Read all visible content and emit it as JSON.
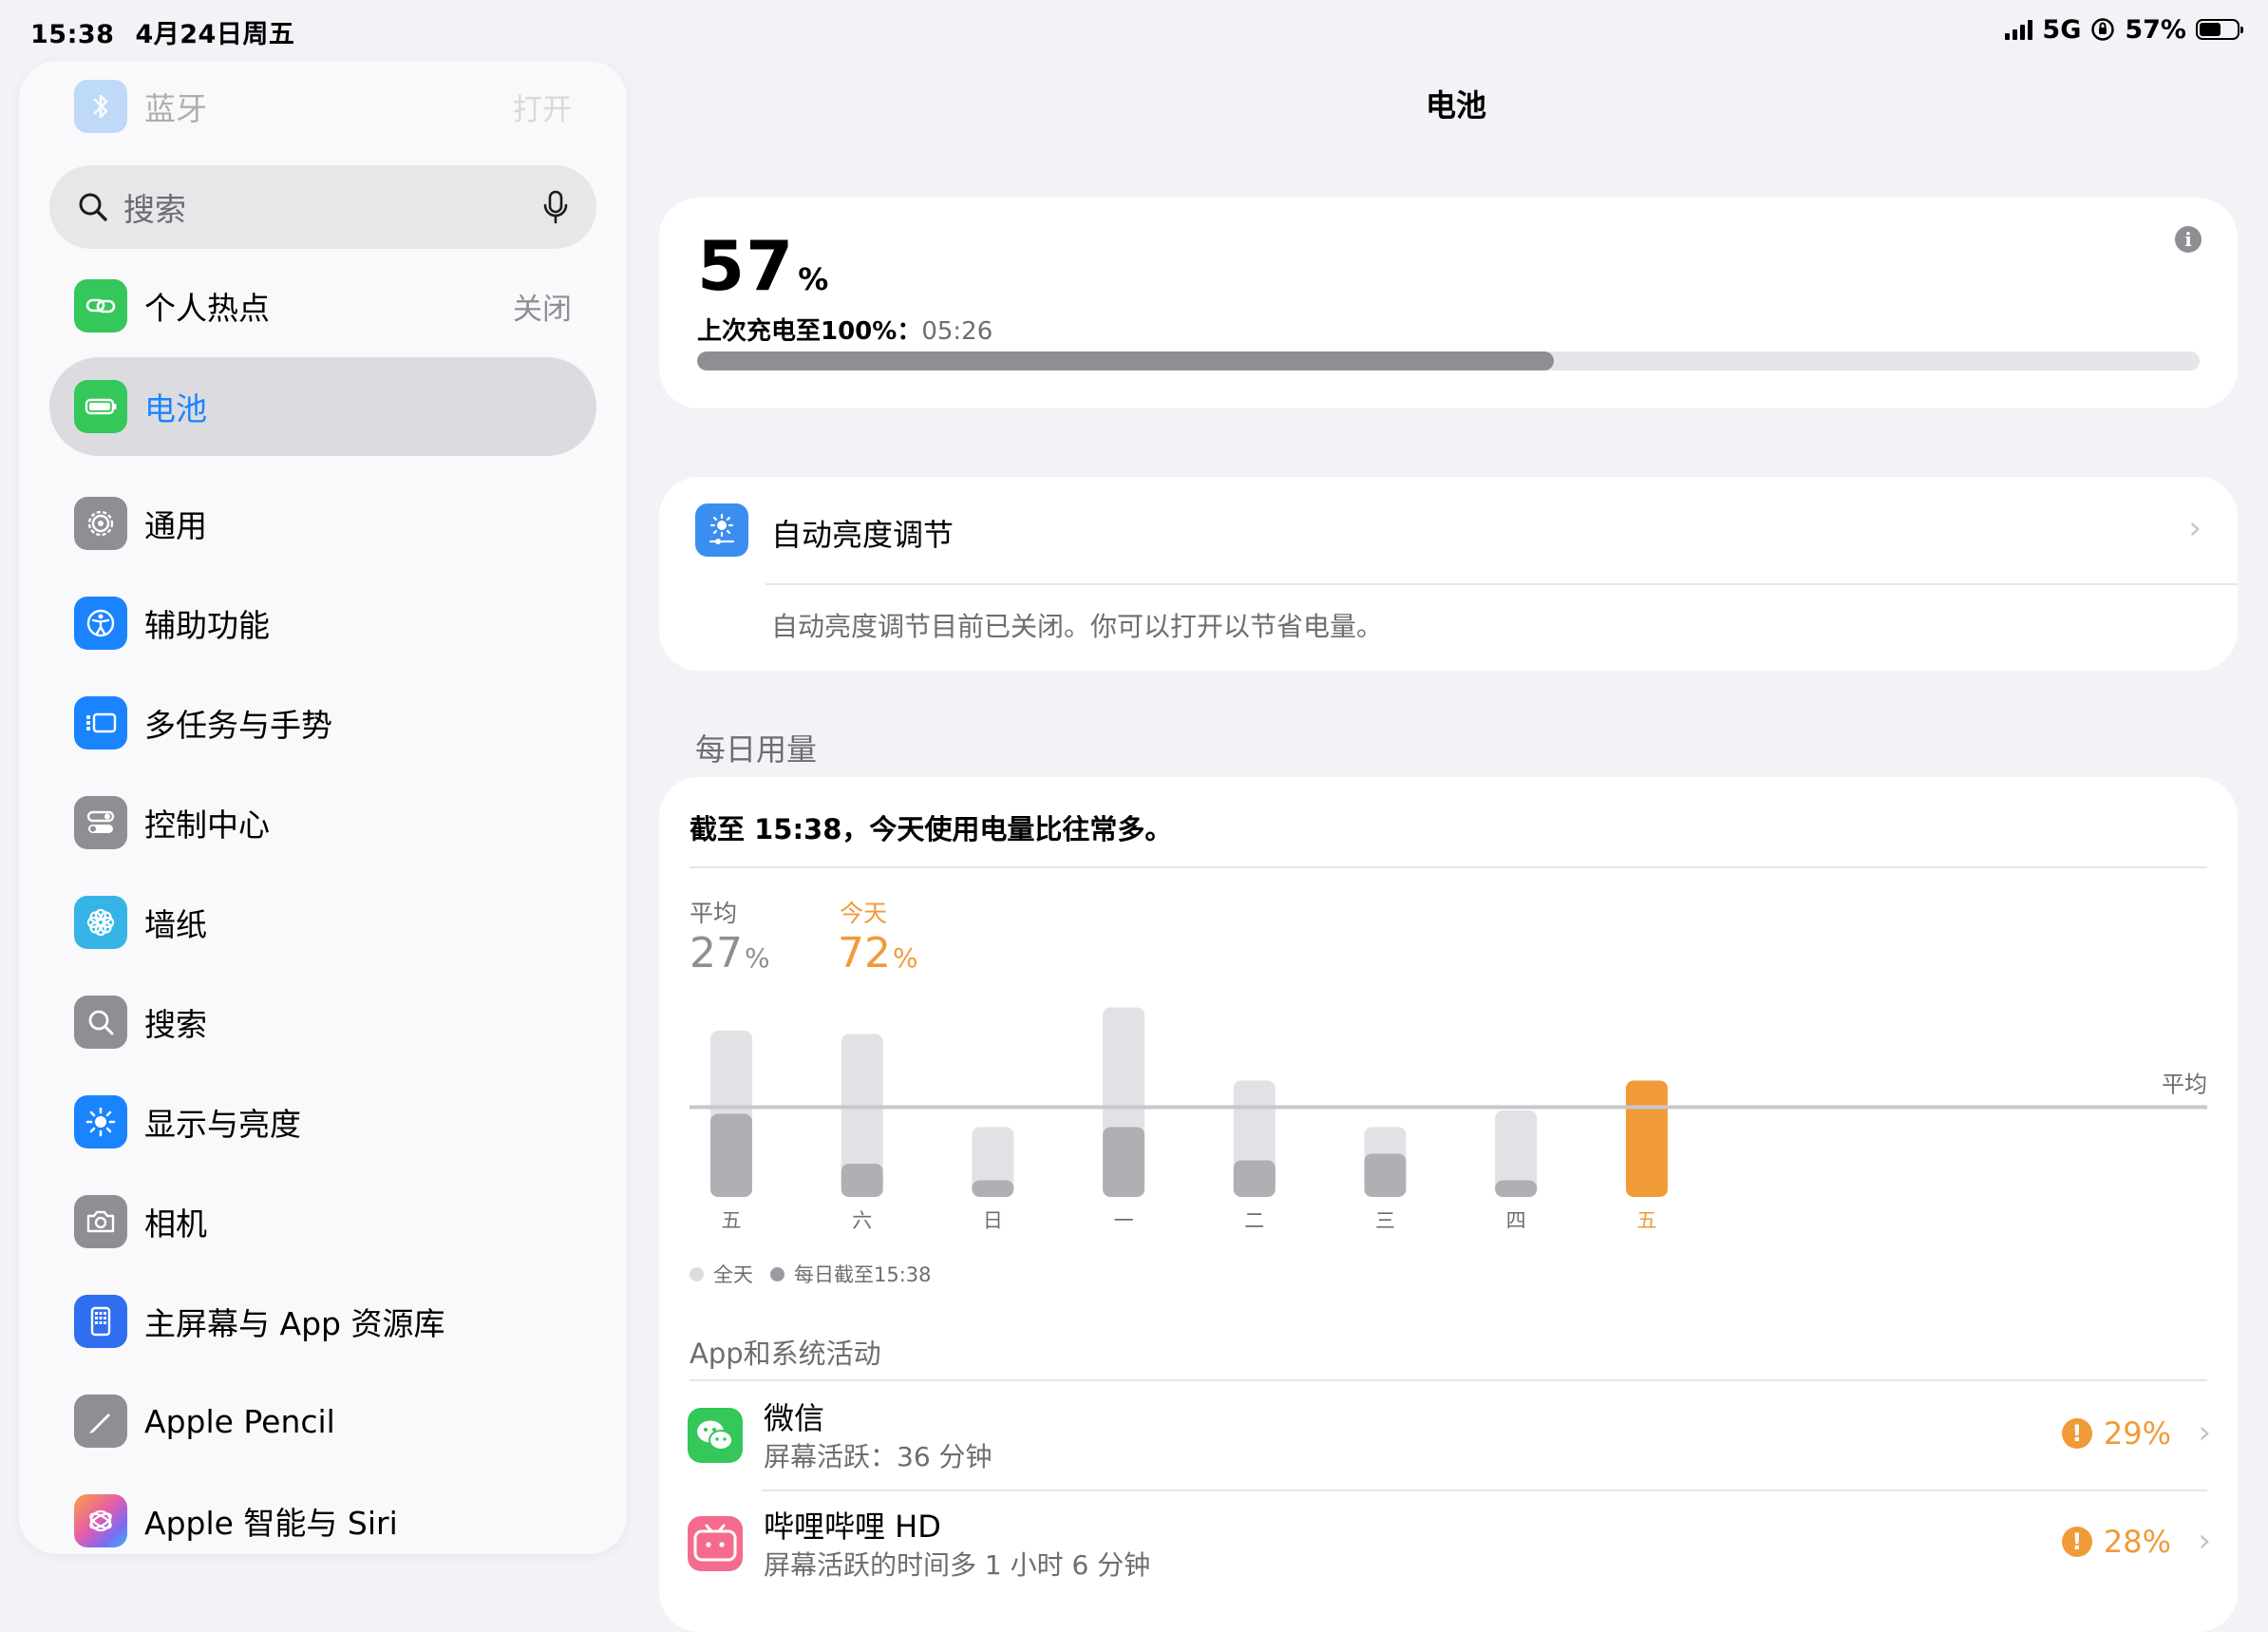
{
  "status_bar": {
    "time": "15:38",
    "date": "4月24日周五",
    "network": "5G",
    "battery_percent": "57%",
    "battery_level": 0.57
  },
  "sidebar": {
    "search_placeholder": "搜索",
    "items": [
      {
        "label": "蓝牙",
        "value": "打开",
        "icon": "bluetooth-icon",
        "color": "#3a8ef0"
      },
      {
        "label": "个人热点",
        "value": "关闭",
        "icon": "hotspot-icon",
        "color": "#34c759"
      },
      {
        "label": "电池",
        "value": "",
        "icon": "battery-icon",
        "color": "#34c759",
        "selected": true
      },
      {
        "label": "通用",
        "value": "",
        "icon": "gear-icon",
        "color": "#8e8e93"
      },
      {
        "label": "辅助功能",
        "value": "",
        "icon": "accessibility-icon",
        "color": "#1a84ff"
      },
      {
        "label": "多任务与手势",
        "value": "",
        "icon": "multitasking-icon",
        "color": "#1a84ff"
      },
      {
        "label": "控制中心",
        "value": "",
        "icon": "control-center-icon",
        "color": "#8e8e93"
      },
      {
        "label": "墙纸",
        "value": "",
        "icon": "wallpaper-icon",
        "color": "#36b4e8"
      },
      {
        "label": "搜索",
        "value": "",
        "icon": "search-icon",
        "color": "#8e8e93"
      },
      {
        "label": "显示与亮度",
        "value": "",
        "icon": "brightness-icon",
        "color": "#1a84ff"
      },
      {
        "label": "相机",
        "value": "",
        "icon": "camera-icon",
        "color": "#8e8e93"
      },
      {
        "label": "主屏幕与 App 资源库",
        "value": "",
        "icon": "home-screen-icon",
        "color": "#2f6ef0"
      },
      {
        "label": "Apple Pencil",
        "value": "",
        "icon": "pencil-icon",
        "color": "#8e8e93"
      },
      {
        "label": "Apple 智能与 Siri",
        "value": "",
        "icon": "siri-icon",
        "color": "#e57bd0"
      }
    ]
  },
  "main": {
    "title": "电池",
    "battery": {
      "percent": "57",
      "percent_unit": "%",
      "level": 0.57,
      "last_charge_label": "上次充电至100%：",
      "last_charge_time": "05:26"
    },
    "auto_brightness": {
      "title": "自动亮度调节",
      "description": "自动亮度调节目前已关闭。你可以打开以节省电量。"
    },
    "daily_usage_title": "每日用量",
    "usage": {
      "headline": "截至 15:38，今天使用电量比往常多。",
      "average_label": "平均",
      "average_value": "27",
      "today_label": "今天",
      "today_value": "72",
      "unit": "%"
    },
    "legend": {
      "all_day": "全天",
      "until_now": "每日截至15:38"
    },
    "app_section_title": "App和系统活动",
    "apps": [
      {
        "name": "微信",
        "detail": "屏幕活跃：36 分钟",
        "percent": "29%",
        "icon": "wechat-icon"
      },
      {
        "name": "哔哩哔哩 HD",
        "detail": "屏幕活跃的时间多 1 小时 6 分钟",
        "percent": "28%",
        "icon": "bilibili-icon"
      }
    ]
  },
  "colors": {
    "accent_blue": "#1a84ff",
    "today_orange": "#f19a38",
    "bar_full": "#e2e2e6",
    "bar_partial": "#b0b0b4"
  },
  "chart_data": {
    "type": "bar",
    "categories": [
      "五",
      "六",
      "日",
      "一",
      "二",
      "三",
      "四",
      "五"
    ],
    "series": [
      {
        "name": "全天",
        "values": [
          50,
          49,
          21,
          57,
          35,
          21,
          26,
          35
        ]
      },
      {
        "name": "每日截至15:38",
        "values": [
          25,
          10,
          5,
          21,
          11,
          13,
          5,
          35
        ]
      }
    ],
    "highlight_index": 7,
    "average_line_label": "平均",
    "grid": false,
    "legend_position": "bottom-left"
  }
}
